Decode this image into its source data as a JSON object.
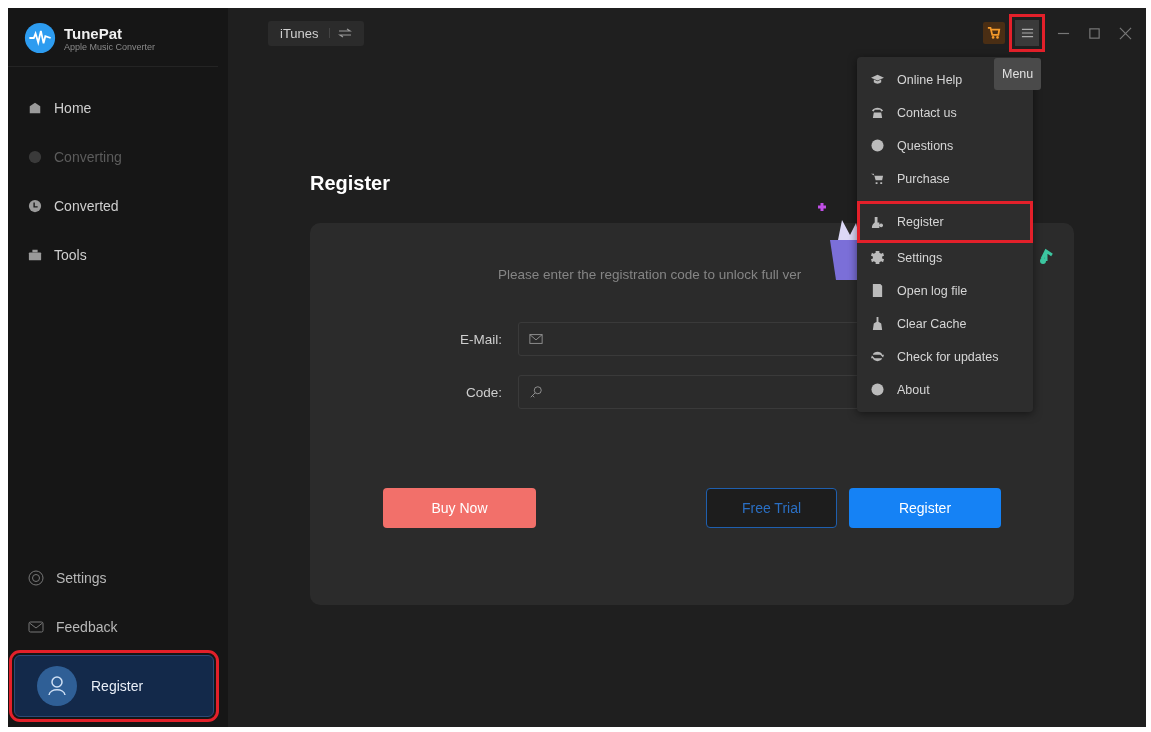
{
  "app": {
    "name": "TunePat",
    "subtitle": "Apple Music Converter"
  },
  "sidebar": {
    "items": [
      {
        "label": "Home",
        "disabled": false
      },
      {
        "label": "Converting",
        "disabled": true
      },
      {
        "label": "Converted",
        "disabled": false
      },
      {
        "label": "Tools",
        "disabled": false
      }
    ],
    "bottom_items": [
      {
        "label": "Settings"
      },
      {
        "label": "Feedback"
      }
    ],
    "register": {
      "label": "Register",
      "highlighted": true
    }
  },
  "source_switch": {
    "label": "iTunes"
  },
  "toolbar": {
    "menu_highlighted": true,
    "tooltip": "Menu"
  },
  "menu": {
    "items": [
      {
        "label": "Online Help",
        "highlighted": false
      },
      {
        "label": "Contact us",
        "highlighted": false
      },
      {
        "label": "Questions",
        "highlighted": false
      },
      {
        "label": "Purchase",
        "highlighted": false
      },
      {
        "label": "Register",
        "highlighted": true
      },
      {
        "label": "Settings",
        "highlighted": false
      },
      {
        "label": "Open log file",
        "highlighted": false
      },
      {
        "label": "Clear Cache",
        "highlighted": false
      },
      {
        "label": "Check for updates",
        "highlighted": false
      },
      {
        "label": "About",
        "highlighted": false
      }
    ]
  },
  "page": {
    "title": "Register",
    "message": "Please enter the registration code to unlock full ver",
    "fields": [
      {
        "label": "E-Mail:"
      },
      {
        "label": "Code:"
      }
    ],
    "buttons": [
      {
        "label": "Buy Now",
        "kind": "buy"
      },
      {
        "label": "Free Trial",
        "kind": "outline"
      },
      {
        "label": "Register",
        "kind": "primary"
      }
    ]
  }
}
